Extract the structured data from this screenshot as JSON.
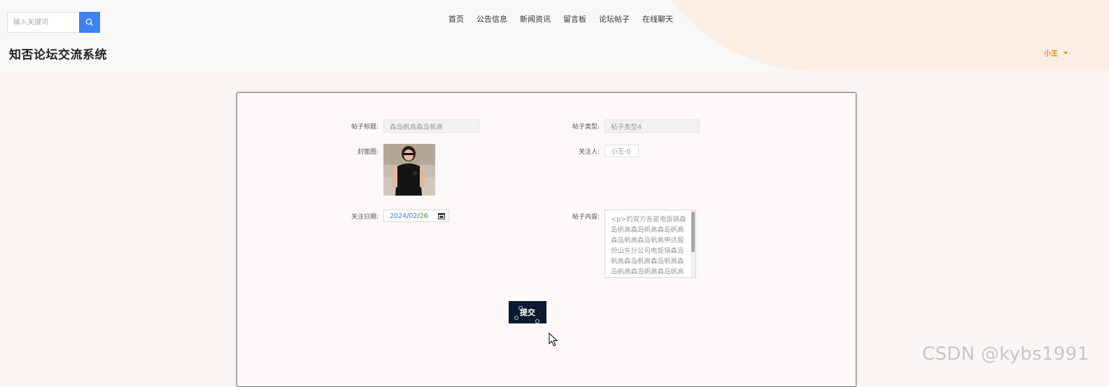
{
  "header": {
    "search": {
      "placeholder": "输入关键词",
      "icon": "search-icon"
    },
    "nav": [
      "首页",
      "公告信息",
      "新闻资讯",
      "留言板",
      "论坛帖子",
      "在线聊天"
    ],
    "site_title": "知否论坛交流系统",
    "user": {
      "name": "小王",
      "icon": "caret-down-icon"
    }
  },
  "form": {
    "title": {
      "label": "帖子标题:",
      "value": "森岛帆高森岛帆高"
    },
    "type": {
      "label": "帖子类型:",
      "value": "帖子类型4"
    },
    "cover": {
      "label": "封面图:"
    },
    "follower": {
      "label": "关注人:",
      "value": "小王-0"
    },
    "date": {
      "label": "关注日期:",
      "year": "2024",
      "sep1": "/",
      "month": "02",
      "sep2": "/",
      "day": "26",
      "icon": "calendar-icon"
    },
    "content": {
      "label": "帖子内容:",
      "value": "<p>的双方各是电饭锅森岛帆高森岛帆高森岛帆高森岛帆高森岛帆高申达股份山东分公司电饭锅森岛帆高森岛帆高森岛帆高森岛帆高森岛帆高森岛帆高"
    },
    "submit_label": "提交"
  },
  "watermark": "CSDN @kybs1991",
  "colors": {
    "accent": "#3d82f5",
    "user": "#e08a2c",
    "button": "#0b1a2e"
  }
}
